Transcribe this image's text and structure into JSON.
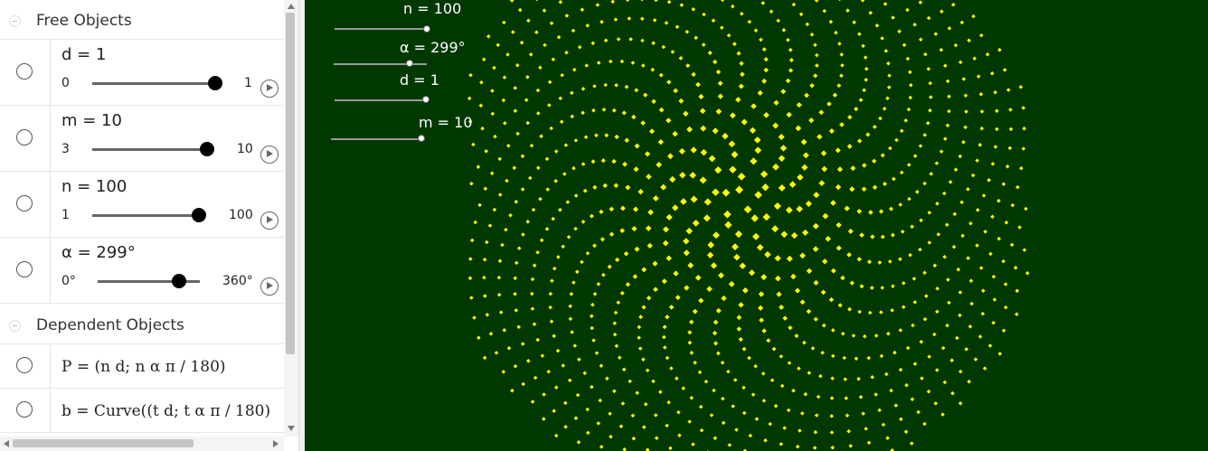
{
  "algebra": {
    "free_title": "Free Objects",
    "dependent_title": "Dependent Objects",
    "sliders": [
      {
        "label": "d = 1",
        "min": "0",
        "max": "1",
        "fraction": 1.0
      },
      {
        "label": "m = 10",
        "min": "3",
        "max": "10",
        "fraction": 1.0
      },
      {
        "label": "n = 100",
        "min": "1",
        "max": "100",
        "fraction": 1.0
      },
      {
        "label": "α = 299°",
        "min": "0°",
        "max": "360°",
        "fraction": 0.83
      }
    ],
    "dependent": [
      {
        "label": "P = (n d; n α π / 180)"
      },
      {
        "label": "b = Curve((t d; t α π / 180)"
      }
    ]
  },
  "graphics": {
    "background": "#003800",
    "point_color": "#ffff00",
    "sliders": [
      {
        "label": "n = 100",
        "fraction": 1.0
      },
      {
        "label": "α = 299°",
        "fraction": 0.83
      },
      {
        "label": "d = 1",
        "fraction": 1.0
      },
      {
        "label": "m = 10",
        "fraction": 1.0
      }
    ]
  }
}
